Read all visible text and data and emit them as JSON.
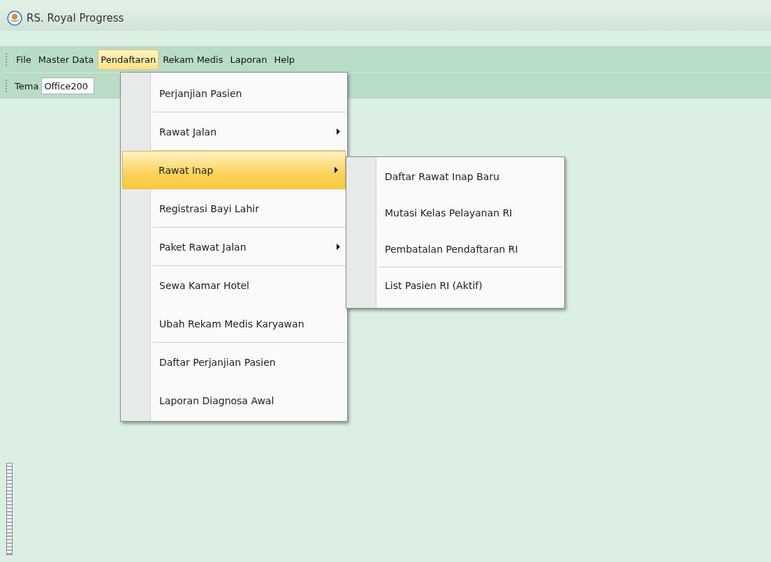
{
  "window": {
    "title": "RS. Royal Progress"
  },
  "menubar": [
    {
      "label": "File",
      "selected": false
    },
    {
      "label": "Master Data",
      "selected": false
    },
    {
      "label": "Pendaftaran",
      "selected": true
    },
    {
      "label": "Rekam Medis",
      "selected": false
    },
    {
      "label": "Laporan",
      "selected": false
    },
    {
      "label": "Help",
      "selected": false
    }
  ],
  "toolbar": {
    "label": "Tema",
    "value": "Office200"
  },
  "menu": [
    {
      "label": "Perjanjian Pasien",
      "submenu": false,
      "selected": false,
      "separator_after": true
    },
    {
      "label": "Rawat Jalan",
      "submenu": true,
      "selected": false,
      "separator_after": true
    },
    {
      "label": "Rawat Inap",
      "submenu": true,
      "selected": true,
      "separator_after": false
    },
    {
      "label": "Registrasi Bayi Lahir",
      "submenu": false,
      "selected": false,
      "separator_after": true
    },
    {
      "label": "Paket Rawat Jalan",
      "submenu": true,
      "selected": false,
      "separator_after": true
    },
    {
      "label": "Sewa Kamar Hotel",
      "submenu": false,
      "selected": false,
      "separator_after": false
    },
    {
      "label": "Ubah Rekam Medis Karyawan",
      "submenu": false,
      "selected": false,
      "separator_after": true
    },
    {
      "label": "Daftar Perjanjian Pasien",
      "submenu": false,
      "selected": false,
      "separator_after": false
    },
    {
      "label": "Laporan Diagnosa Awal",
      "submenu": false,
      "selected": false,
      "separator_after": false
    }
  ],
  "submenu": [
    {
      "label": "Daftar Rawat Inap Baru",
      "separator_after": false
    },
    {
      "label": "Mutasi Kelas Pelayanan RI",
      "separator_after": false
    },
    {
      "label": "Pembatalan Pendaftaran RI",
      "separator_after": true
    },
    {
      "label": "List Pasien RI (Aktif)",
      "separator_after": false
    }
  ]
}
